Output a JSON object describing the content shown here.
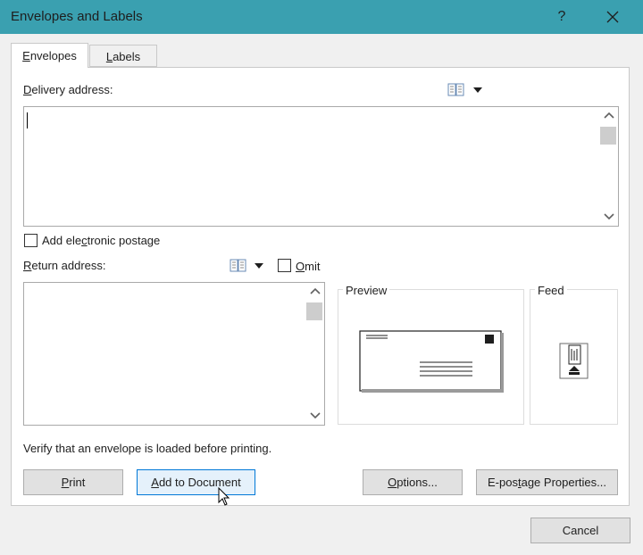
{
  "window": {
    "title": "Envelopes and Labels",
    "help_label": "?"
  },
  "tabs": [
    {
      "label": "Envelopes",
      "accel": "E",
      "rest": "nvelopes",
      "selected": true
    },
    {
      "label": "Labels",
      "accel": "L",
      "rest": "abels",
      "selected": false
    }
  ],
  "delivery": {
    "label_accel": "D",
    "label_rest": "elivery address:",
    "value": "",
    "icon": "address-book-icon"
  },
  "postage": {
    "label_before": "Add ele",
    "label_accel": "c",
    "label_after": "tronic postage",
    "checked": false
  },
  "return": {
    "label_accel": "R",
    "label_rest": "eturn address:",
    "value": "",
    "icon": "address-book-icon"
  },
  "omit": {
    "label_accel": "O",
    "label_rest": "mit",
    "checked": false
  },
  "preview": {
    "label": "Preview"
  },
  "feed": {
    "label": "Feed"
  },
  "verify_text": "Verify that an envelope is loaded before printing.",
  "buttons": {
    "print": {
      "accel": "P",
      "rest": "rint"
    },
    "add_to_document": {
      "accel": "A",
      "rest": "dd to Document"
    },
    "options": {
      "accel": "O",
      "rest": "ptions..."
    },
    "epostage": {
      "before": "E-pos",
      "accel": "t",
      "after": "age Properties..."
    },
    "cancel": "Cancel"
  },
  "colors": {
    "titlebar": "#3aa0b0",
    "focus_border": "#0078d7"
  }
}
